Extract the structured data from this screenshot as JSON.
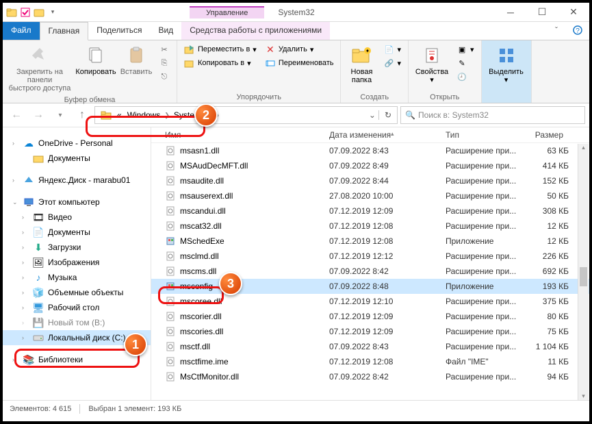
{
  "window": {
    "context_tab": "Управление",
    "title": "System32"
  },
  "tabs": {
    "file": "Файл",
    "home": "Главная",
    "share": "Поделиться",
    "view": "Вид",
    "app": "Средства работы с приложениями"
  },
  "ribbon": {
    "clipboard": {
      "label": "Буфер обмена",
      "pin": "Закрепить на панели\nбыстрого доступа",
      "copy": "Копировать",
      "paste": "Вставить"
    },
    "organize": {
      "label": "Упорядочить",
      "move": "Переместить в",
      "copy": "Копировать в",
      "delete": "Удалить",
      "rename": "Переименовать"
    },
    "new": {
      "label": "Создать",
      "folder": "Новая\nпапка"
    },
    "open": {
      "label": "Открыть",
      "props": "Свойства"
    },
    "select": {
      "label": "",
      "btn": "Выделить"
    }
  },
  "breadcrumb": {
    "prefix": "«",
    "items": [
      "Windows",
      "System32"
    ]
  },
  "search": {
    "placeholder": "Поиск в: System32"
  },
  "nav": {
    "onedrive": "OneDrive - Personal",
    "documents": "Документы",
    "yandex": "Яндекс.Диск - marabu01",
    "thispc": "Этот компьютер",
    "videos": "Видео",
    "documents2": "Документы",
    "downloads": "Загрузки",
    "pictures": "Изображения",
    "music": "Музыка",
    "objects3d": "Объемные объекты",
    "desktop": "Рабочий стол",
    "newvol": "Новый том (B:)",
    "localdisk": "Локальный диск (C:)",
    "libraries": "Библиотеки"
  },
  "columns": {
    "name": "Имя",
    "modified": "Дата изменения",
    "type": "Тип",
    "size": "Размер"
  },
  "files": [
    {
      "name": "msasn1.dll",
      "date": "07.09.2022 8:43",
      "type": "Расширение при...",
      "size": "63 КБ"
    },
    {
      "name": "MSAudDecMFT.dll",
      "date": "07.09.2022 8:49",
      "type": "Расширение при...",
      "size": "414 КБ"
    },
    {
      "name": "msaudite.dll",
      "date": "07.09.2022 8:44",
      "type": "Расширение при...",
      "size": "152 КБ"
    },
    {
      "name": "msauserext.dll",
      "date": "27.08.2020 10:00",
      "type": "Расширение при...",
      "size": "50 КБ"
    },
    {
      "name": "mscandui.dll",
      "date": "07.12.2019 12:09",
      "type": "Расширение при...",
      "size": "308 КБ"
    },
    {
      "name": "mscat32.dll",
      "date": "07.12.2019 12:08",
      "type": "Расширение при...",
      "size": "12 КБ"
    },
    {
      "name": "MSchedExe",
      "date": "07.12.2019 12:08",
      "type": "Приложение",
      "size": "12 КБ"
    },
    {
      "name": "msclmd.dll",
      "date": "07.12.2019 12:12",
      "type": "Расширение при...",
      "size": "226 КБ"
    },
    {
      "name": "mscms.dll",
      "date": "07.09.2022 8:42",
      "type": "Расширение при...",
      "size": "692 КБ"
    },
    {
      "name": "msconfig",
      "date": "07.09.2022 8:48",
      "type": "Приложение",
      "size": "193 КБ",
      "selected": true
    },
    {
      "name": "mscoree.dll",
      "date": "07.12.2019 12:10",
      "type": "Расширение при...",
      "size": "375 КБ"
    },
    {
      "name": "mscorier.dll",
      "date": "07.12.2019 12:09",
      "type": "Расширение при...",
      "size": "80 КБ"
    },
    {
      "name": "mscories.dll",
      "date": "07.12.2019 12:09",
      "type": "Расширение при...",
      "size": "75 КБ"
    },
    {
      "name": "msctf.dll",
      "date": "07.09.2022 8:43",
      "type": "Расширение при...",
      "size": "1 104 КБ"
    },
    {
      "name": "msctfime.ime",
      "date": "07.12.2019 12:08",
      "type": "Файл \"IME\"",
      "size": "11 КБ"
    },
    {
      "name": "MsCtfMonitor.dll",
      "date": "07.09.2022 8:42",
      "type": "Расширение при...",
      "size": "94 КБ"
    }
  ],
  "status": {
    "count_label": "Элементов:",
    "count": "4 615",
    "selection": "Выбран 1 элемент: 193 КБ"
  },
  "callouts": {
    "1": "1",
    "2": "2",
    "3": "3"
  }
}
